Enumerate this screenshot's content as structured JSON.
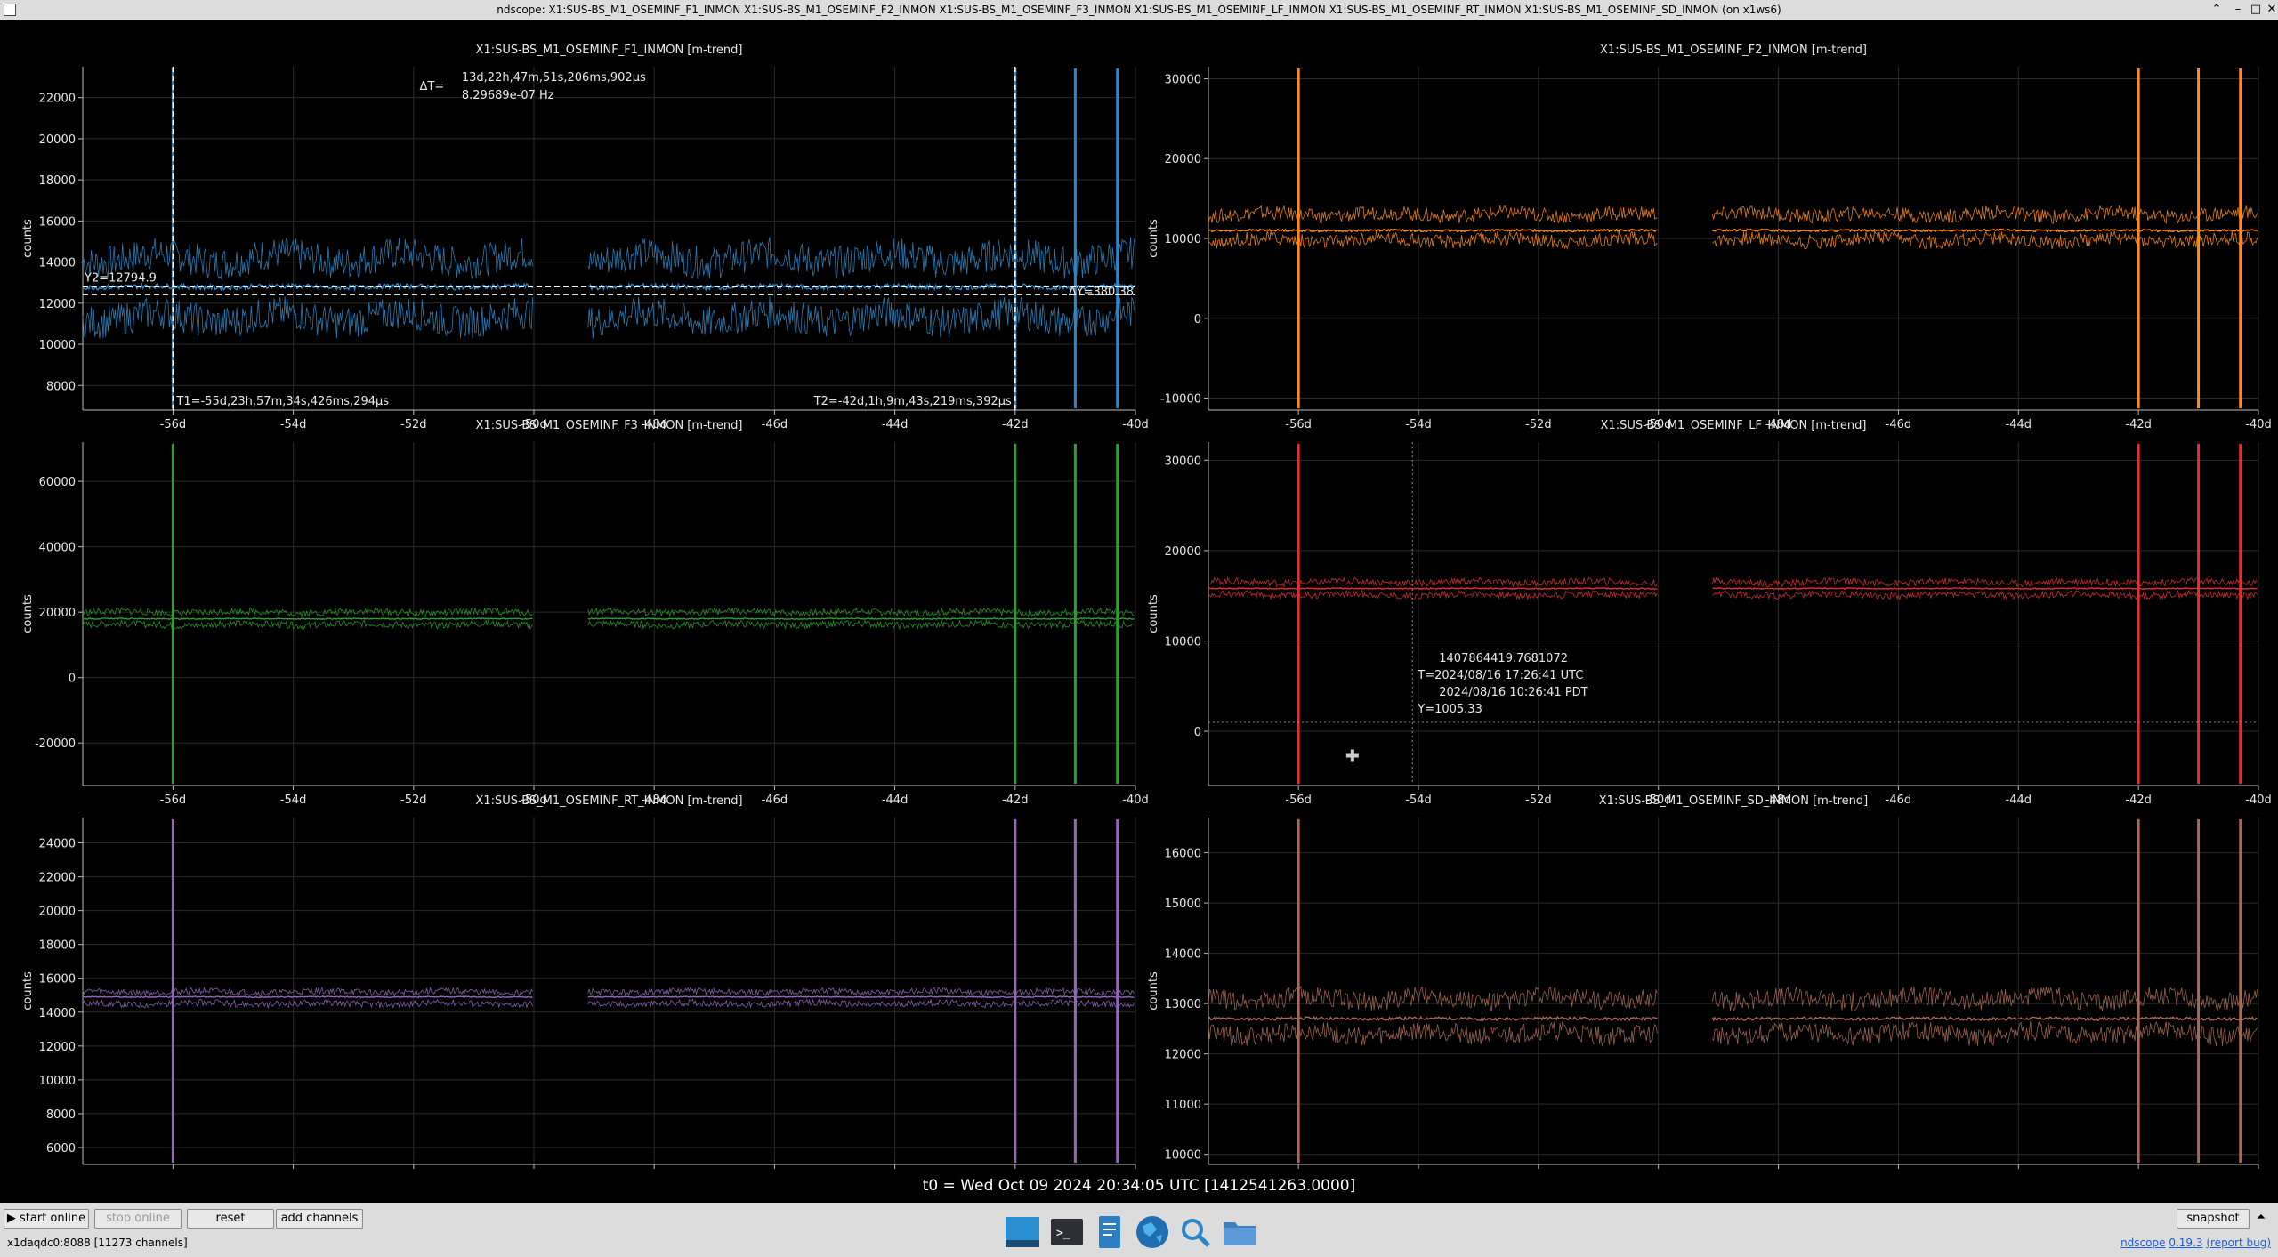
{
  "window": {
    "title": "ndscope: X1:SUS-BS_M1_OSEMINF_F1_INMON X1:SUS-BS_M1_OSEMINF_F2_INMON X1:SUS-BS_M1_OSEMINF_F3_INMON X1:SUS-BS_M1_OSEMINF_LF_INMON X1:SUS-BS_M1_OSEMINF_RT_INMON X1:SUS-BS_M1_OSEMINF_SD_INMON (on x1ws6)"
  },
  "colors": {
    "f1": "#2f87c8",
    "f2": "#ff8c1a",
    "f3": "#2ca02c",
    "lf": "#e03030",
    "rt": "#9467bd",
    "sd": "#a86a58"
  },
  "t0_label": "t0 = Wed Oct 09 2024 20:34:05 UTC [1412541263.0000]",
  "chart_data": [
    {
      "type": "line",
      "title": "X1:SUS-BS_M1_OSEMINF_F1_INMON [m-trend]",
      "ylabel": "counts",
      "xlim": [
        -57.5,
        -40
      ],
      "ylim": [
        6800,
        23500
      ],
      "xticks": [
        "-56d",
        "-54d",
        "-52d",
        "-50d",
        "-48d",
        "-46d",
        "-44d",
        "-42d",
        "-40d"
      ],
      "yticks": [
        8000,
        10000,
        12000,
        14000,
        16000,
        18000,
        20000,
        22000
      ],
      "mean": 12800,
      "max": 14200,
      "min": 11300,
      "cursors": {
        "T1": "T1=-55d,23h,57m,34s,426ms,294µs",
        "T2": "T2=-42d,1h,9m,43s,219ms,392µs",
        "dT_label": "ΔT=",
        "dT": "13d,22h,47m,51s,206ms,902µs",
        "freq": "8.29689e-07 Hz",
        "Y2": "Y2=12794.9",
        "dY": "ΔY=380.38"
      }
    },
    {
      "type": "line",
      "title": "X1:SUS-BS_M1_OSEMINF_F2_INMON [m-trend]",
      "ylabel": "counts",
      "xlim": [
        -57.5,
        -40
      ],
      "ylim": [
        -11500,
        31500
      ],
      "xticks": [
        "-56d",
        "-54d",
        "-52d",
        "-50d",
        "-48d",
        "-46d",
        "-44d",
        "-42d",
        "-40d"
      ],
      "yticks": [
        -10000,
        0,
        10000,
        20000,
        30000
      ],
      "mean": 11000,
      "max": 13000,
      "min": 9800
    },
    {
      "type": "line",
      "title": "X1:SUS-BS_M1_OSEMINF_F3_INMON [m-trend]",
      "ylabel": "counts",
      "xlim": [
        -57.5,
        -40
      ],
      "ylim": [
        -33000,
        72000
      ],
      "xticks": [
        "-56d",
        "-54d",
        "-52d",
        "-50d",
        "-48d",
        "-46d",
        "-44d",
        "-42d",
        "-40d"
      ],
      "yticks": [
        -20000,
        0,
        20000,
        40000,
        60000
      ],
      "mean": 18000,
      "max": 20000,
      "min": 16200
    },
    {
      "type": "line",
      "title": "X1:SUS-BS_M1_OSEMINF_LF_INMON [m-trend]",
      "ylabel": "counts",
      "xlim": [
        -57.5,
        -40
      ],
      "ylim": [
        -6000,
        32000
      ],
      "xticks": [
        "-56d",
        "-54d",
        "-52d",
        "-50d",
        "-48d",
        "-46d",
        "-44d",
        "-42d",
        "-40d"
      ],
      "yticks": [
        0,
        10000,
        20000,
        30000
      ],
      "mean": 15800,
      "max": 16500,
      "min": 15100,
      "crosshair": {
        "gps": "1407864419.7681072",
        "utc": "T=2024/08/16 17:26:41 UTC",
        "pdt": "2024/08/16 10:26:41 PDT",
        "y": "Y=1005.33"
      }
    },
    {
      "type": "line",
      "title": "X1:SUS-BS_M1_OSEMINF_RT_INMON [m-trend]",
      "ylabel": "counts",
      "xlim": [
        -57.5,
        -40
      ],
      "ylim": [
        5000,
        25500
      ],
      "xticks": [
        "-56d",
        "-54d",
        "-52d",
        "-50d",
        "-48d",
        "-46d",
        "-44d",
        "-42d",
        "-40d"
      ],
      "yticks": [
        6000,
        8000,
        10000,
        12000,
        14000,
        16000,
        18000,
        20000,
        22000,
        24000
      ],
      "mean": 14900,
      "max": 15200,
      "min": 14500
    },
    {
      "type": "line",
      "title": "X1:SUS-BS_M1_OSEMINF_SD_INMON [m-trend]",
      "ylabel": "counts",
      "xlim": [
        -57.5,
        -40
      ],
      "ylim": [
        9800,
        16700
      ],
      "xticks": [
        "-56d",
        "-54d",
        "-52d",
        "-50d",
        "-48d",
        "-46d",
        "-44d",
        "-42d",
        "-40d"
      ],
      "yticks": [
        10000,
        11000,
        12000,
        13000,
        14000,
        15000,
        16000
      ],
      "mean": 12700,
      "max": 13100,
      "min": 12400
    }
  ],
  "controls": {
    "start_online": "▶ start online",
    "stop_online": "stop online",
    "reset": "reset",
    "add_channels": "add channels",
    "snapshot": "snapshot",
    "expand_arrow": "⏶"
  },
  "status": {
    "server": "x1daqdc0:8088  [11273 channels]",
    "version_prefix": "ndscope",
    "version": "0.19.3",
    "report_bug": "(report bug)"
  },
  "taskbar": [
    "desktop-icon",
    "terminal-icon",
    "text-editor-icon",
    "browser-icon",
    "search-icon",
    "file-manager-icon"
  ]
}
